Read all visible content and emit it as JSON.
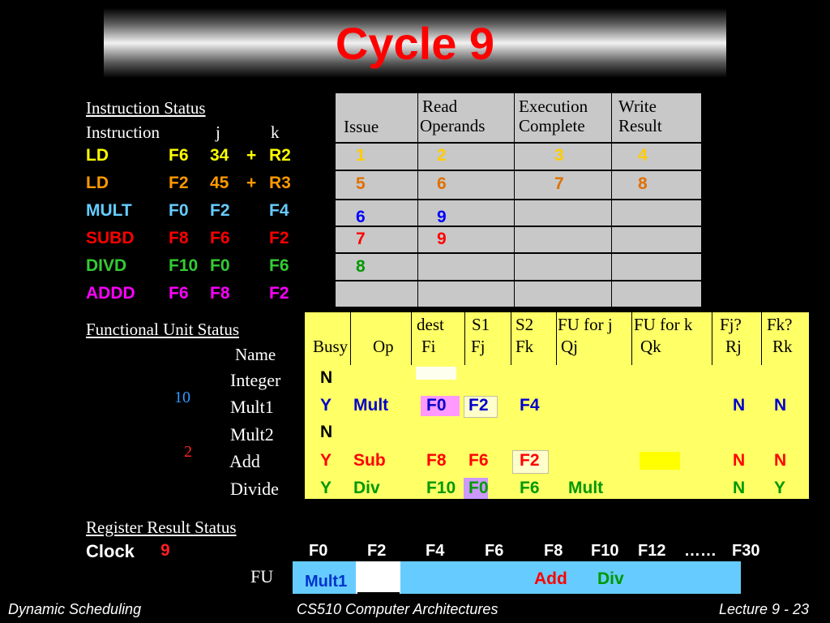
{
  "title": "Cycle 9",
  "instruction_status": {
    "heading": "Instruction Status",
    "col_instruction": "Instruction",
    "col_j": "j",
    "col_k": "k",
    "rows": [
      {
        "op": "LD",
        "dest": "F6",
        "j": "34",
        "plus": "+",
        "k": "R2",
        "color": "#ffff00"
      },
      {
        "op": "LD",
        "dest": "F2",
        "j": "45",
        "plus": "+",
        "k": "R3",
        "color": "#ff9900"
      },
      {
        "op": "MULT",
        "dest": "F0",
        "j": "F2",
        "plus": "",
        "k": "F4",
        "color": "#66ccff"
      },
      {
        "op": "SUBD",
        "dest": "F8",
        "j": "F6",
        "plus": "",
        "k": "F2",
        "color": "#ff0000"
      },
      {
        "op": "DIVD",
        "dest": "F10",
        "j": "F0",
        "plus": "",
        "k": "F6",
        "color": "#33cc33"
      },
      {
        "op": "ADDD",
        "dest": "F6",
        "j": "F8",
        "plus": "",
        "k": "F2",
        "color": "#ff00ff"
      }
    ]
  },
  "status_table": {
    "headers": {
      "issue": "Issue",
      "read_1": "Read",
      "read_2": "Operands",
      "exec_1": "Execution",
      "exec_2": "Complete",
      "write_1": "Write",
      "write_2": "Result"
    },
    "rows": [
      {
        "issue": "1",
        "read": "2",
        "exec": "3",
        "write": "4",
        "color": "#ffcc00"
      },
      {
        "issue": "5",
        "read": "6",
        "exec": "7",
        "write": "8",
        "color": "#e07000"
      },
      {
        "issue": "6",
        "read": "9",
        "exec": "",
        "write": "",
        "color": "#0000ff"
      },
      {
        "issue": "7",
        "read": "9",
        "exec": "",
        "write": "",
        "color": "#ff0000"
      },
      {
        "issue": "8",
        "read": "",
        "exec": "",
        "write": "",
        "color": "#009900"
      },
      {
        "issue": "",
        "read": "",
        "exec": "",
        "write": "",
        "color": "#000000"
      }
    ]
  },
  "functional_unit_status": {
    "heading": "Functional Unit Status",
    "name_label": "Name",
    "headers": {
      "busy": "Busy",
      "op": "Op",
      "dest_1": "dest",
      "dest_2": "Fi",
      "s1_1": "S1",
      "s1_2": "Fj",
      "s2_1": "S2",
      "s2_2": "Fk",
      "fuj_1": "FU for j",
      "fuj_2": "Qj",
      "fuk_1": "FU for k",
      "fuk_2": "Qk",
      "fjq_1": "Fj?",
      "fjq_2": "Rj",
      "fkq_1": "Fk?",
      "fkq_2": "Rk"
    },
    "units": [
      {
        "name": "Integer",
        "timer": "",
        "busy": "N",
        "op": "",
        "fi": "",
        "fj": "",
        "fk": "",
        "qj": "",
        "qk": "",
        "rj": "",
        "rk": ""
      },
      {
        "name": "Mult1",
        "timer": "10",
        "busy": "Y",
        "op": "Mult",
        "fi": "F0",
        "fj": "F2",
        "fk": "F4",
        "qj": "",
        "qk": "",
        "rj": "N",
        "rk": "N"
      },
      {
        "name": "Mult2",
        "timer": "",
        "busy": "N",
        "op": "",
        "fi": "",
        "fj": "",
        "fk": "",
        "qj": "",
        "qk": "",
        "rj": "",
        "rk": ""
      },
      {
        "name": "Add",
        "timer": "2",
        "busy": "Y",
        "op": "Sub",
        "fi": "F8",
        "fj": "F6",
        "fk": "F2",
        "qj": "",
        "qk": "",
        "rj": "N",
        "rk": "N"
      },
      {
        "name": "Divide",
        "timer": "",
        "busy": "Y",
        "op": "Div",
        "fi": "F10",
        "fj": "F0",
        "fk": "F6",
        "qj": "Mult",
        "qk": "",
        "rj": "N",
        "rk": "Y"
      }
    ]
  },
  "register_result_status": {
    "heading": "Register Result Status",
    "clock_label": "Clock",
    "clock_value": "9",
    "fu_label": "FU",
    "registers": [
      "F0",
      "F2",
      "F4",
      "F6",
      "F8",
      "F10",
      "F12",
      "……",
      "F30"
    ],
    "fu_values": {
      "F0": "Mult1",
      "F8": "Add",
      "F10": "Div"
    }
  },
  "footer": {
    "left": "Dynamic Scheduling",
    "center": "CS510 Computer Architectures",
    "right": "Lecture 9 - 23"
  }
}
